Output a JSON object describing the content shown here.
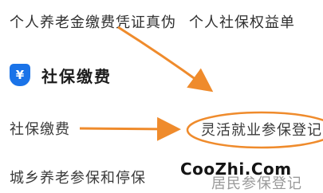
{
  "top_links": [
    "个人养老金缴费凭证真伪",
    "个人社保权益单"
  ],
  "section": {
    "icon": "yuan-shield-icon",
    "icon_glyph": "¥",
    "title": "社保缴费"
  },
  "items": {
    "left_1": "社保缴费",
    "right_1": "灵活就业参保登记",
    "left_2": "城乡养老参保和停保",
    "right_2": "居民参保登记"
  },
  "watermark": "CooZhi.Com",
  "colors": {
    "accent": "#1a73e8",
    "annotation": "#ef8b2c"
  }
}
